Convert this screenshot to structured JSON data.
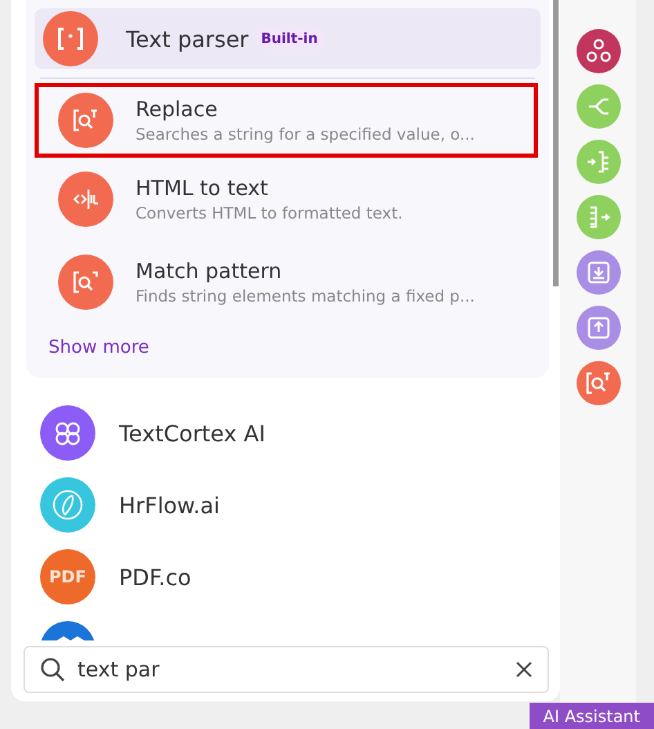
{
  "group": {
    "title": "Text parser",
    "badge": "Built-in",
    "items": [
      {
        "name": "Replace",
        "description": "Searches a string for a specified value, o...",
        "kind": "replace",
        "highlighted": true
      },
      {
        "name": "HTML to text",
        "description": "Converts HTML to formatted text.",
        "kind": "html",
        "highlighted": false
      },
      {
        "name": "Match pattern",
        "description": "Finds string elements matching a fixed p...",
        "kind": "match",
        "highlighted": false
      }
    ],
    "show_more": "Show more"
  },
  "apps": [
    {
      "name": "TextCortex AI",
      "color": "#8b5cf6"
    },
    {
      "name": "HrFlow.ai",
      "color": "#38c6de"
    },
    {
      "name": "PDF.co",
      "label": "PDF",
      "color": "#ee6a2b"
    },
    {
      "color": "#1b74d8"
    }
  ],
  "search": {
    "value": "text par"
  },
  "sidebar": [
    {
      "color": "#c2365e"
    },
    {
      "color": "#8fd15f"
    },
    {
      "color": "#8fd15f"
    },
    {
      "color": "#8fd15f"
    },
    {
      "color": "#a98ee6"
    },
    {
      "color": "#a98ee6"
    },
    {
      "color": "#f26b50"
    }
  ],
  "assistant": {
    "label": "AI Assistant"
  }
}
